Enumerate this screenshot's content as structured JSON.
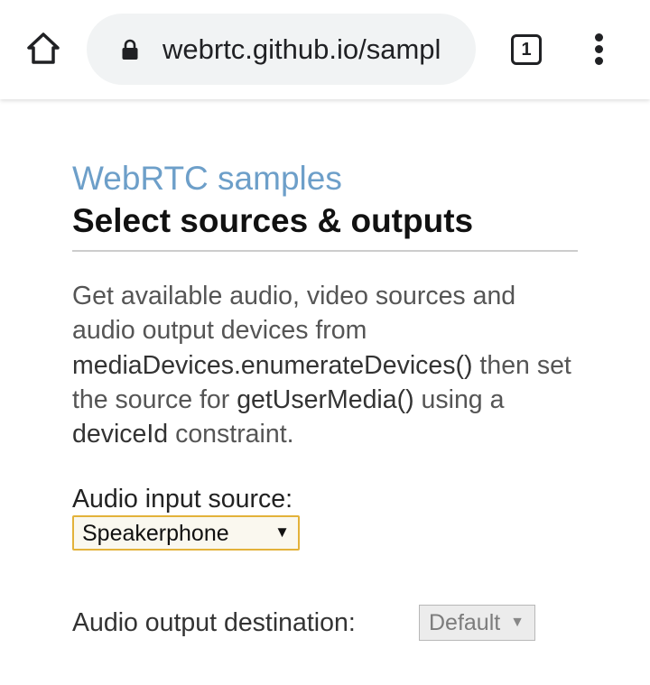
{
  "browser": {
    "url_display": "webrtc.github.io/sampl",
    "tab_count": "1",
    "icons": {
      "home": "home-icon",
      "lock": "lock-icon",
      "tabs": "tab-switcher-icon",
      "menu": "more-vert-icon"
    }
  },
  "page": {
    "site_title": "WebRTC samples",
    "title": "Select sources & outputs",
    "description": {
      "part1": "Get available audio, video sources and audio output devices from ",
      "code1": "mediaDevices.enumerateDevices()",
      "part2": " then set the source for ",
      "code2": "getUserMedia()",
      "part3": " using a ",
      "code3": "deviceId",
      "part4": " constraint."
    },
    "audio_input": {
      "label": "Audio input source:",
      "selected": "Speakerphone"
    },
    "audio_output": {
      "label": "Audio output destination:",
      "selected": "Default",
      "disabled": true
    }
  },
  "colors": {
    "site_title": "#6d9fc9",
    "select_focus_border": "#e3b23a",
    "omnibox_bg": "#f1f3f4"
  }
}
